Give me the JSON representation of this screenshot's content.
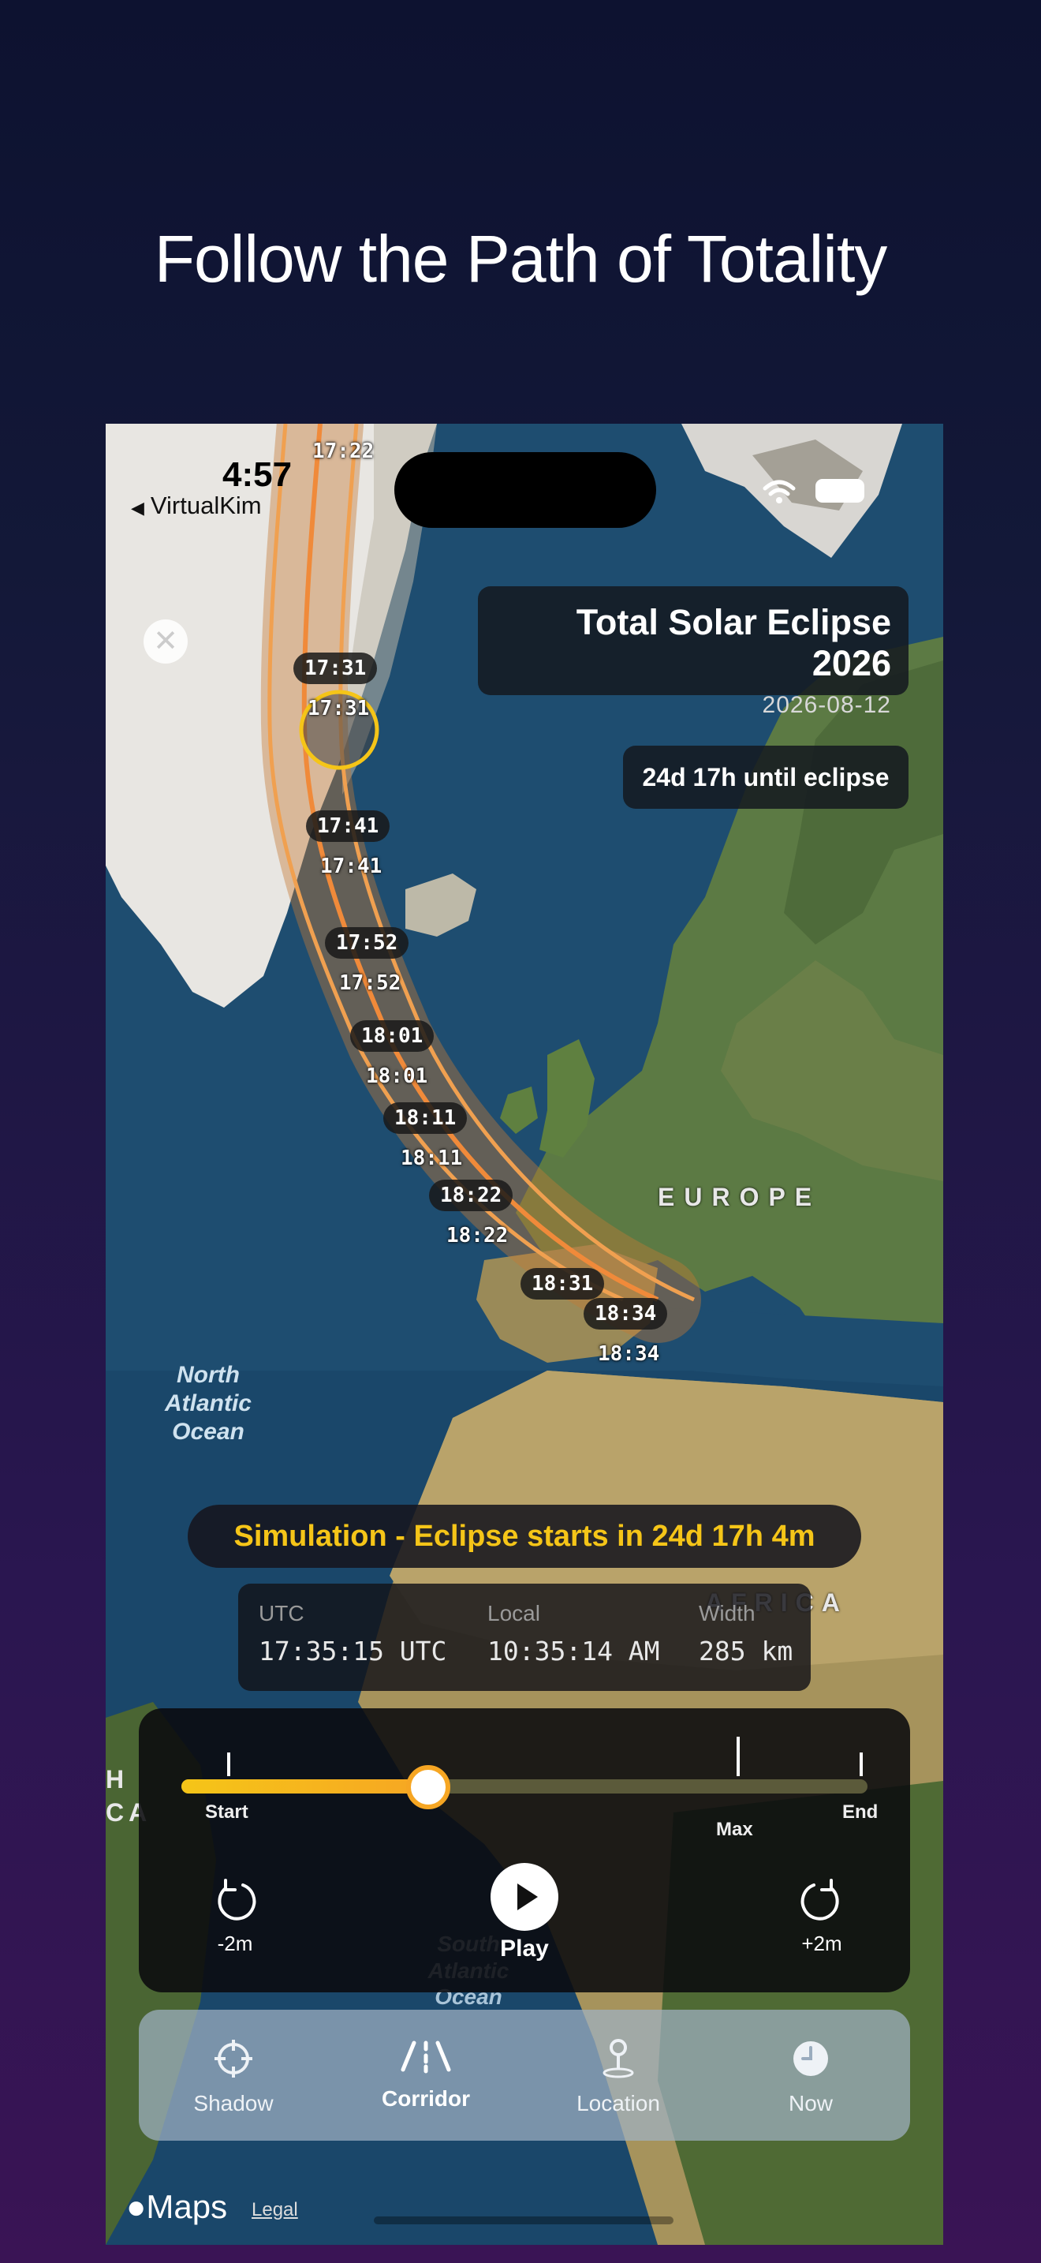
{
  "headline": "Follow the Path of Totality",
  "status_bar": {
    "time": "4:57",
    "back_app": "VirtualKim"
  },
  "eclipse_card": {
    "title": "Total Solar Eclipse 2026",
    "date": "2026-08-12"
  },
  "countdown_chip": "24d 17h until eclipse",
  "map_labels": {
    "europe": "EUROPE",
    "africa": "AFRICA",
    "north_atlantic": "North\nAtlantic\nOcean",
    "south_atlantic": "South\nAtlantic\nOcean",
    "edge_left_1": "H",
    "edge_left_2": "CA"
  },
  "path_times": {
    "top": "17:22",
    "t1_chip": "17:31",
    "t1_plain": "17:31",
    "t2_chip": "17:41",
    "t2_plain": "17:41",
    "t3_chip": "17:52",
    "t3_plain": "17:52",
    "t4_chip": "18:01",
    "t4_plain": "18:01",
    "t5_chip": "18:11",
    "t5_plain": "18:11",
    "t6_chip": "18:22",
    "t6_plain": "18:22",
    "t7_chip": "18:31",
    "t8_chip": "18:34",
    "t8_plain": "18:34"
  },
  "simulation_banner": "Simulation - Eclipse starts in 24d 17h 4m",
  "stats": {
    "utc_label": "UTC",
    "utc_value": "17:35:15 UTC",
    "local_label": "Local",
    "local_value": "10:35:14 AM",
    "width_label": "Width",
    "width_value": "285 km"
  },
  "timeline": {
    "progress": 0.36,
    "start_label": "Start",
    "max_label": "Max",
    "end_label": "End",
    "back_label": "-2m",
    "play_label": "Play",
    "forward_label": "+2m"
  },
  "tabs": [
    {
      "label": "Shadow",
      "icon": "crosshair-icon",
      "active": false
    },
    {
      "label": "Corridor",
      "icon": "road-icon",
      "active": true
    },
    {
      "label": "Location",
      "icon": "pin-icon",
      "active": false
    },
    {
      "label": "Now",
      "icon": "clock-icon",
      "active": false
    }
  ],
  "footer": {
    "maps": "Maps",
    "legal": "Legal"
  },
  "colors": {
    "accent_yellow": "#f5c518",
    "path_orange": "#f0a050",
    "ocean": "#1d4a6e"
  }
}
